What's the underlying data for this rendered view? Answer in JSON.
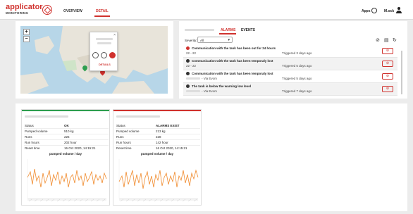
{
  "header": {
    "logo": "applicator",
    "logo_sub": "MONITORING",
    "nav": [
      "OVERVIEW",
      "DETAIL"
    ],
    "apps_label": "Apps",
    "user_label": "M.ock"
  },
  "map": {
    "zoom_in": "+",
    "zoom_out": "−",
    "popup_action": "DETAILS"
  },
  "alarms": {
    "tabs": [
      "ALARMS",
      "EVENTS"
    ],
    "severity_label": "Severity:",
    "severity_value": "All",
    "items": [
      {
        "title": "Communication with the tank has been out for 24 hours",
        "sub": "22 - 22",
        "time": "Triggered 3 days ago",
        "color": "#d0312d"
      },
      {
        "title": "Communication with the tank has been temporaly lost",
        "sub": "22 - 22",
        "time": "Triggered 5 days ago",
        "color": "#333333"
      },
      {
        "title": "Communication with the tank has been temporaly lost",
        "sub": "- Via Evom",
        "time": "Triggered 5 days ago",
        "color": "#333333"
      },
      {
        "title": "The tank is below the warning low level",
        "sub": "- Via Evom",
        "time": "Triggered 7 days ago",
        "color": "#333333"
      }
    ]
  },
  "cards": [
    {
      "accent": "#2e9e4f",
      "rows": [
        {
          "k": "Status",
          "v": "OK"
        },
        {
          "k": "Pumped volume",
          "v": "510 kg"
        },
        {
          "k": "Runs",
          "v": "226"
        },
        {
          "k": "Run hours",
          "v": "202 hour"
        },
        {
          "k": "Reset time",
          "v": "16 Oct 2020, 14:15:21"
        }
      ],
      "chart_title": "pumped volume / day",
      "line_color": "#f08a2c"
    },
    {
      "accent": "#d0312d",
      "rows": [
        {
          "k": "Status",
          "v": "ALARMS EXIST"
        },
        {
          "k": "Pumped volume",
          "v": "213 kg"
        },
        {
          "k": "Runs",
          "v": "228"
        },
        {
          "k": "Run hours",
          "v": "142 hour"
        },
        {
          "k": "Reset time",
          "v": "16 Oct 2020, 14:15:21"
        }
      ],
      "chart_title": "pumped volume / day",
      "line_color": "#f08a2c"
    }
  ]
}
